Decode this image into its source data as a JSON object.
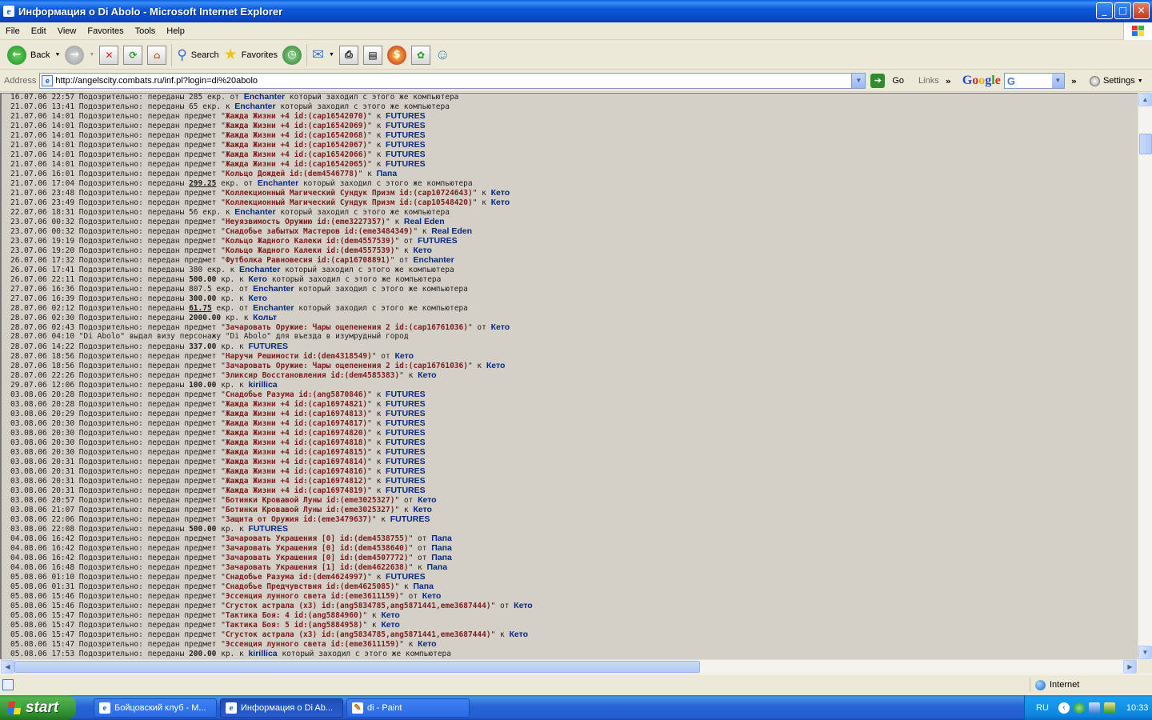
{
  "window": {
    "title": "Информация о Di Abolo - Microsoft Internet Explorer",
    "minimize": "_",
    "maximize": "□",
    "close": "✕"
  },
  "menu": [
    "File",
    "Edit",
    "View",
    "Favorites",
    "Tools",
    "Help"
  ],
  "toolbar": {
    "back": "Back",
    "search": "Search",
    "favorites": "Favorites"
  },
  "address": {
    "label": "Address",
    "url": "http://angelscity.combats.ru/inf.pl?login=di%20abolo",
    "go": "Go",
    "links": "Links",
    "settings": "Settings"
  },
  "log": [
    [
      "16.07.06 22:57 Подозрительно: переданы 285 екр. от ",
      {
        "n": "Enchanter"
      },
      " который заходил с этого же компьютера"
    ],
    [
      "21.07.06 13:41 Подозрительно: переданы 65 екр. к ",
      {
        "n": "Enchanter"
      },
      " который заходил с этого же компьютера"
    ],
    [
      "21.07.06 14:01 Подозрительно: передан предмет \"",
      {
        "i": "Жажда Жизни +4 id:(cap16542070)"
      },
      "\" к ",
      {
        "n": "FUTURES"
      }
    ],
    [
      "21.07.06 14:01 Подозрительно: передан предмет \"",
      {
        "i": "Жажда Жизни +4 id:(cap16542069)"
      },
      "\" к ",
      {
        "n": "FUTURES"
      }
    ],
    [
      "21.07.06 14:01 Подозрительно: передан предмет \"",
      {
        "i": "Жажда Жизни +4 id:(cap16542068)"
      },
      "\" к ",
      {
        "n": "FUTURES"
      }
    ],
    [
      "21.07.06 14:01 Подозрительно: передан предмет \"",
      {
        "i": "Жажда Жизни +4 id:(cap16542067)"
      },
      "\" к ",
      {
        "n": "FUTURES"
      }
    ],
    [
      "21.07.06 14:01 Подозрительно: передан предмет \"",
      {
        "i": "Жажда Жизни +4 id:(cap16542066)"
      },
      "\" к ",
      {
        "n": "FUTURES"
      }
    ],
    [
      "21.07.06 14:01 Подозрительно: передан предмет \"",
      {
        "i": "Жажда Жизни +4 id:(cap16542065)"
      },
      "\" к ",
      {
        "n": "FUTURES"
      }
    ],
    [
      "21.07.06 16:01 Подозрительно: передан предмет \"",
      {
        "i": "Кольцо Дождей id:(dem4546778)"
      },
      "\" к ",
      {
        "n": "Папа"
      }
    ],
    [
      "21.07.06 17:04 Подозрительно: переданы ",
      {
        "u": "299.25"
      },
      " екр. от ",
      {
        "n": "Enchanter"
      },
      " который заходил с этого же компьютера"
    ],
    [
      "21.07.06 23:48 Подозрительно: передан предмет \"",
      {
        "i": "Коллекционный Магический Сундук Призм id:(cap10724643)"
      },
      "\" к ",
      {
        "n": "Кето"
      }
    ],
    [
      "21.07.06 23:49 Подозрительно: передан предмет \"",
      {
        "i": "Коллекционный Магический Сундук Призм id:(cap10548420)"
      },
      "\" к ",
      {
        "n": "Кето"
      }
    ],
    [
      "22.07.06 18:31 Подозрительно: переданы 56 екр. к ",
      {
        "n": "Enchanter"
      },
      " который заходил с этого же компьютера"
    ],
    [
      "23.07.06 00:32 Подозрительно: передан предмет \"",
      {
        "i": "Неуязвимость Оружию id:(eme3227357)"
      },
      "\" к ",
      {
        "n": "Real Eden"
      }
    ],
    [
      "23.07.06 00:32 Подозрительно: передан предмет \"",
      {
        "i": "Снадобье забытых Мастеров id:(eme3484349)"
      },
      "\" к ",
      {
        "n": "Real Eden"
      }
    ],
    [
      "23.07.06 19:19 Подозрительно: передан предмет \"",
      {
        "i": "Кольцо Жадного Калеки id:(dem4557539)"
      },
      "\" от ",
      {
        "n": "FUTURES"
      }
    ],
    [
      "23.07.06 19:20 Подозрительно: передан предмет \"",
      {
        "i": "Кольцо Жадного Калеки id:(dem4557539)"
      },
      "\" к ",
      {
        "n": "Кето"
      }
    ],
    [
      "26.07.06 17:32 Подозрительно: передан предмет \"",
      {
        "i": "Футболка Равновесия id:(cap16708891)"
      },
      "\" от ",
      {
        "n": "Enchanter"
      }
    ],
    [
      "26.07.06 17:41 Подозрительно: переданы 380 екр. к ",
      {
        "n": "Enchanter"
      },
      " который заходил с этого же компьютера"
    ],
    [
      "26.07.06 22:11 Подозрительно: переданы ",
      {
        "b": "500.00"
      },
      " кр. к ",
      {
        "n": "Кето"
      },
      " который заходил с этого же компьютера"
    ],
    [
      "27.07.06 16:36 Подозрительно: переданы 807.5 екр. от ",
      {
        "n": "Enchanter"
      },
      " который заходил с этого же компьютера"
    ],
    [
      "27.07.06 16:39 Подозрительно: переданы ",
      {
        "b": "300.00"
      },
      " кр. к ",
      {
        "n": "Кето"
      }
    ],
    [
      "28.07.06 02:12 Подозрительно: переданы ",
      {
        "u": "61.75"
      },
      " екр. от ",
      {
        "n": "Enchanter"
      },
      " который заходил с этого же компьютера"
    ],
    [
      "28.07.06 02:30 Подозрительно: переданы ",
      {
        "b": "2000.00"
      },
      " кр. к ",
      {
        "n": "Кольт"
      }
    ],
    [
      "28.07.06 02:43 Подозрительно: передан предмет \"",
      {
        "i": "Зачаровать Оружие: Чары оцепенения 2 id:(cap16761036)"
      },
      "\" от ",
      {
        "n": "Кето"
      }
    ],
    [
      "28.07.06 04:10 \"Di Abolo\" выдал визу персонажу \"Di Abolo\" для въезда в изумрудный город"
    ],
    [
      "28.07.06 14:22 Подозрительно: переданы ",
      {
        "b": "337.00"
      },
      " кр. к ",
      {
        "n": "FUTURES"
      }
    ],
    [
      "28.07.06 18:56 Подозрительно: передан предмет \"",
      {
        "i": "Наручи Решимости id:(dem4318549)"
      },
      "\" от ",
      {
        "n": "Кето"
      }
    ],
    [
      "28.07.06 18:56 Подозрительно: передан предмет \"",
      {
        "i": "Зачаровать Оружие: Чары оцепенения 2 id:(cap16761036)"
      },
      "\" к ",
      {
        "n": "Кето"
      }
    ],
    [
      "28.07.06 22:26 Подозрительно: передан предмет \"",
      {
        "i": "Эликсир Восстановления id:(dem4585383)"
      },
      "\" к ",
      {
        "n": "Кето"
      }
    ],
    [
      "29.07.06 12:06 Подозрительно: переданы ",
      {
        "b": "100.00"
      },
      " кр. к ",
      {
        "n": "kirillica"
      }
    ],
    [
      "03.08.06 20:28 Подозрительно: передан предмет \"",
      {
        "i": "Снадобье Разума id:(ang5870846)"
      },
      "\" к ",
      {
        "n": "FUTURES"
      }
    ],
    [
      "03.08.06 20:28 Подозрительно: передан предмет \"",
      {
        "i": "Жажда Жизни +4 id:(cap16974821)"
      },
      "\" к ",
      {
        "n": "FUTURES"
      }
    ],
    [
      "03.08.06 20:29 Подозрительно: передан предмет \"",
      {
        "i": "Жажда Жизни +4 id:(cap16974813)"
      },
      "\" к ",
      {
        "n": "FUTURES"
      }
    ],
    [
      "03.08.06 20:30 Подозрительно: передан предмет \"",
      {
        "i": "Жажда Жизни +4 id:(cap16974817)"
      },
      "\" к ",
      {
        "n": "FUTURES"
      }
    ],
    [
      "03.08.06 20:30 Подозрительно: передан предмет \"",
      {
        "i": "Жажда Жизни +4 id:(cap16974820)"
      },
      "\" к ",
      {
        "n": "FUTURES"
      }
    ],
    [
      "03.08.06 20:30 Подозрительно: передан предмет \"",
      {
        "i": "Жажда Жизни +4 id:(cap16974818)"
      },
      "\" к ",
      {
        "n": "FUTURES"
      }
    ],
    [
      "03.08.06 20:30 Подозрительно: передан предмет \"",
      {
        "i": "Жажда Жизни +4 id:(cap16974815)"
      },
      "\" к ",
      {
        "n": "FUTURES"
      }
    ],
    [
      "03.08.06 20:31 Подозрительно: передан предмет \"",
      {
        "i": "Жажда Жизни +4 id:(cap16974814)"
      },
      "\" к ",
      {
        "n": "FUTURES"
      }
    ],
    [
      "03.08.06 20:31 Подозрительно: передан предмет \"",
      {
        "i": "Жажда Жизни +4 id:(cap16974816)"
      },
      "\" к ",
      {
        "n": "FUTURES"
      }
    ],
    [
      "03.08.06 20:31 Подозрительно: передан предмет \"",
      {
        "i": "Жажда Жизни +4 id:(cap16974812)"
      },
      "\" к ",
      {
        "n": "FUTURES"
      }
    ],
    [
      "03.08.06 20:31 Подозрительно: передан предмет \"",
      {
        "i": "Жажда Жизни +4 id:(cap16974819)"
      },
      "\" к ",
      {
        "n": "FUTURES"
      }
    ],
    [
      "03.08.06 20:57 Подозрительно: передан предмет \"",
      {
        "i": "Ботинки Кровавой Луны id:(eme3025327)"
      },
      "\" от ",
      {
        "n": "Кето"
      }
    ],
    [
      "03.08.06 21:07 Подозрительно: передан предмет \"",
      {
        "i": "Ботинки Кровавой Луны id:(eme3025327)"
      },
      "\" к ",
      {
        "n": "Кето"
      }
    ],
    [
      "03.08.06 22:06 Подозрительно: передан предмет \"",
      {
        "i": "Защита от Оружия id:(eme3479637)"
      },
      "\" к ",
      {
        "n": "FUTURES"
      }
    ],
    [
      "03.08.06 22:08 Подозрительно: переданы ",
      {
        "b": "500.00"
      },
      " кр. к ",
      {
        "n": "FUTURES"
      }
    ],
    [
      "04.08.06 16:42 Подозрительно: передан предмет \"",
      {
        "i": "Зачаровать Украшения [0] id:(dem4538755)"
      },
      "\" от ",
      {
        "n": "Папа"
      }
    ],
    [
      "04.08.06 16:42 Подозрительно: передан предмет \"",
      {
        "i": "Зачаровать Украшения [0] id:(dem4538640)"
      },
      "\" от ",
      {
        "n": "Папа"
      }
    ],
    [
      "04.08.06 16:42 Подозрительно: передан предмет \"",
      {
        "i": "Зачаровать Украшения [0] id:(dem4507772)"
      },
      "\" от ",
      {
        "n": "Папа"
      }
    ],
    [
      "04.08.06 16:48 Подозрительно: передан предмет \"",
      {
        "i": "Зачаровать Украшения [1] id:(dem4622638)"
      },
      "\" к ",
      {
        "n": "Папа"
      }
    ],
    [
      "05.08.06 01:10 Подозрительно: передан предмет \"",
      {
        "i": "Снадобье Разума id:(dem4624997)"
      },
      "\" к ",
      {
        "n": "FUTURES"
      }
    ],
    [
      "05.08.06 01:31 Подозрительно: передан предмет \"",
      {
        "i": "Снадобье Предчувствия id:(dem4625085)"
      },
      "\" к ",
      {
        "n": "Папа"
      }
    ],
    [
      "05.08.06 15:46 Подозрительно: передан предмет \"",
      {
        "i": "Эссенция лунного света id:(eme3611159)"
      },
      "\" от ",
      {
        "n": "Кето"
      }
    ],
    [
      "05.08.06 15:46 Подозрительно: передан предмет \"",
      {
        "i": "Сгусток астрала (x3) id:(ang5834785,ang5871441,eme3687444)"
      },
      "\" от ",
      {
        "n": "Кето"
      }
    ],
    [
      "05.08.06 15:47 Подозрительно: передан предмет \"",
      {
        "i": "Тактика Боя: 4 id:(ang5884960)"
      },
      "\" к ",
      {
        "n": "Кето"
      }
    ],
    [
      "05.08.06 15:47 Подозрительно: передан предмет \"",
      {
        "i": "Тактика Боя: 5 id:(ang5884958)"
      },
      "\" к ",
      {
        "n": "Кето"
      }
    ],
    [
      "05.08.06 15:47 Подозрительно: передан предмет \"",
      {
        "i": "Сгусток астрала (x3) id:(ang5834785,ang5871441,eme3687444)"
      },
      "\" к ",
      {
        "n": "Кето"
      }
    ],
    [
      "05.08.06 15:47 Подозрительно: передан предмет \"",
      {
        "i": "Эссенция лунного света id:(eme3611159)"
      },
      "\" к ",
      {
        "n": "Кето"
      }
    ],
    [
      "05.08.06 17:53 Подозрительно: переданы ",
      {
        "b": "200.00"
      },
      " кр. к ",
      {
        "n": "kirillica"
      },
      " который заходил с этого же компьютера"
    ]
  ],
  "status": {
    "zone": "Internet"
  },
  "taskbar": {
    "start": "start",
    "tasks": [
      "Бойцовский клуб - M...",
      "Информация о Di Ab...",
      "di - Paint"
    ],
    "lang": "RU",
    "clock": "10:33"
  },
  "colors": {
    "item": "#7a1f1f",
    "nick": "#0a2a80",
    "page_bg": "#d4d0c8"
  }
}
